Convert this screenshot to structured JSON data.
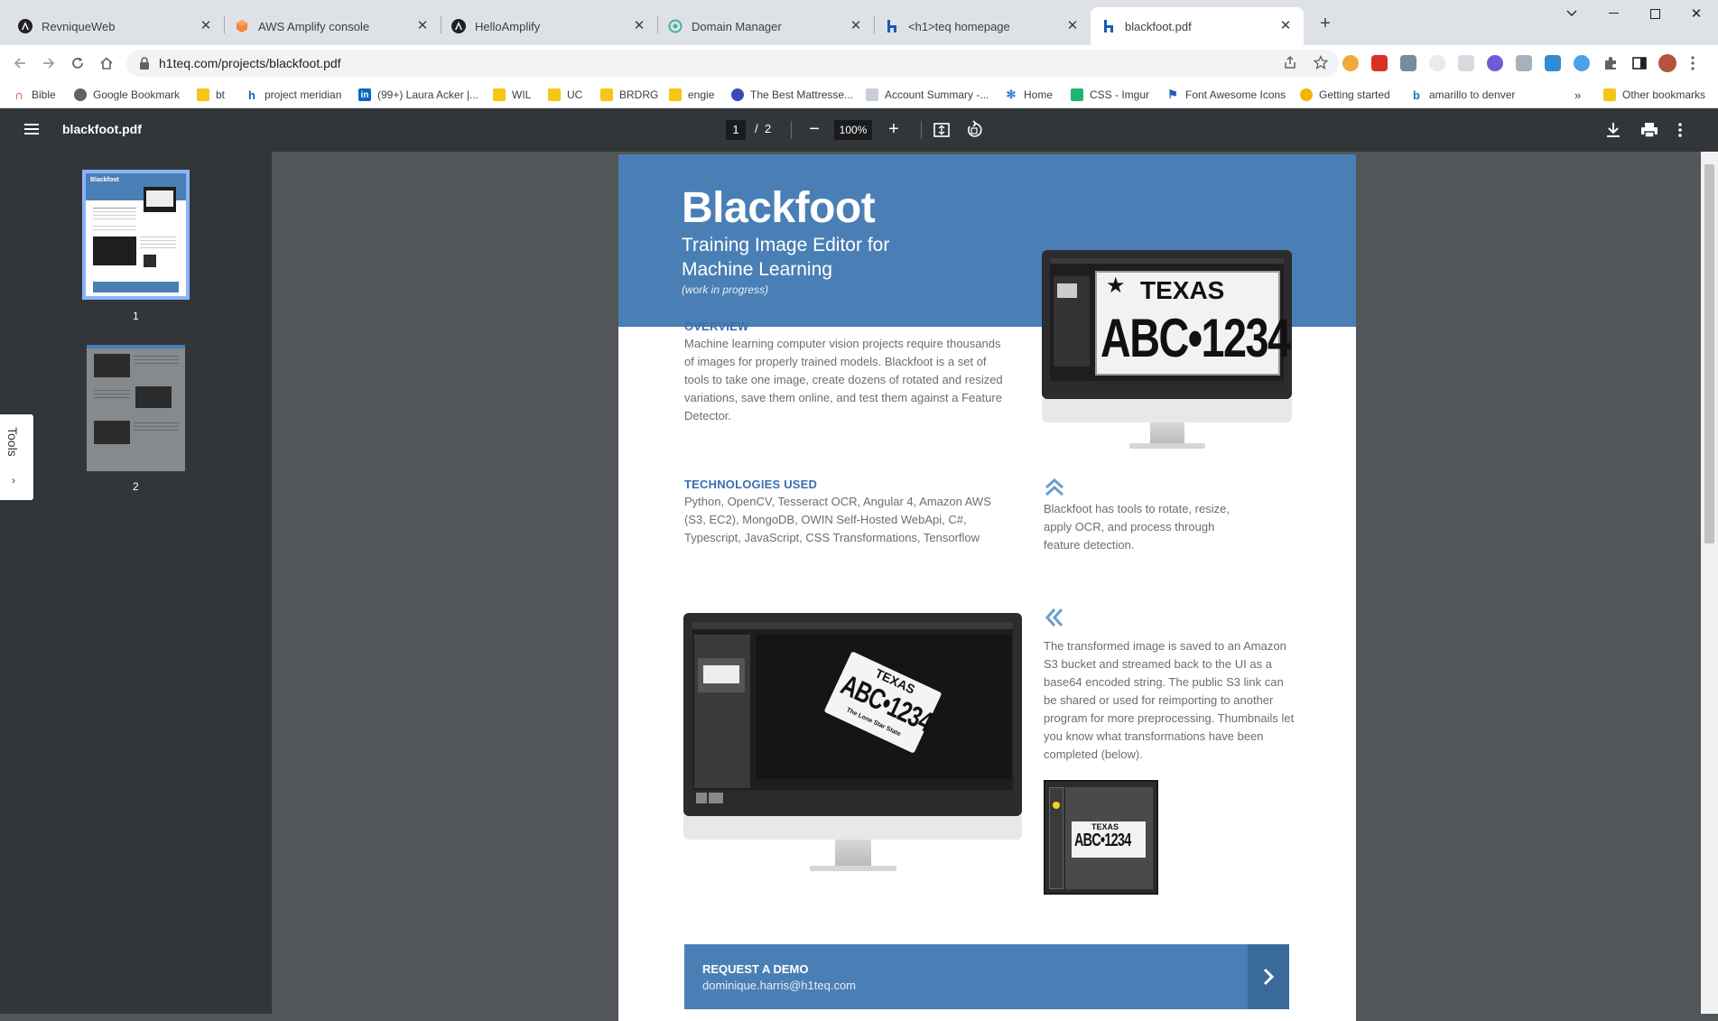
{
  "tabs": [
    {
      "title": "RevniqueWeb",
      "icon": "angular-icon"
    },
    {
      "title": "AWS Amplify console",
      "icon": "aws-icon"
    },
    {
      "title": "HelloAmplify",
      "icon": "angular-icon"
    },
    {
      "title": "Domain Manager",
      "icon": "domain-icon"
    },
    {
      "title": "<h1>teq homepage",
      "icon": "h1teq-icon"
    },
    {
      "title": "blackfoot.pdf",
      "icon": "h1teq-icon"
    }
  ],
  "address": {
    "url": "h1teq.com/projects/blackfoot.pdf"
  },
  "bookmarks": [
    {
      "label": "Bible"
    },
    {
      "label": "Google Bookmark"
    },
    {
      "label": "bt"
    },
    {
      "label": "project meridian"
    },
    {
      "label": "(99+) Laura Acker |..."
    },
    {
      "label": "WIL"
    },
    {
      "label": "UC"
    },
    {
      "label": "BRDRG"
    },
    {
      "label": "engie"
    },
    {
      "label": "The Best Mattresse..."
    },
    {
      "label": "Account Summary -..."
    },
    {
      "label": "Home"
    },
    {
      "label": "CSS - Imgur"
    },
    {
      "label": "Font Awesome Icons"
    },
    {
      "label": "Getting started"
    },
    {
      "label": "amarillo to denver"
    }
  ],
  "bookmarks_overflow": "»",
  "other_bookmarks": "Other bookmarks",
  "pdf": {
    "filename": "blackfoot.pdf",
    "current_page": "1",
    "separator": "/",
    "total_pages": "2",
    "zoom": "100%",
    "tools_label": "Tools",
    "thumbnails": [
      "1",
      "2"
    ]
  },
  "doc": {
    "title": "Blackfoot",
    "subtitle": "Training Image Editor for Machine Learning",
    "note": "(work in progress)",
    "overview_heading": "OVERVIEW",
    "overview_text": "Machine learning computer vision projects require thousands of images for properly trained models. Blackfoot is a set of tools to take one image, create dozens of rotated and resized variations, save them online, and test them against a Feature Detector.",
    "tech_heading": "TECHNOLOGIES USED",
    "tech_text": "Python, OpenCV, Tesseract OCR, Angular 4, Amazon AWS (S3, EC2), MongoDB, OWIN Self-Hosted WebApi, C#, Typescript, JavaScript, CSS Transformations, Tensorflow",
    "tools_text": "Blackfoot has tools to rotate, resize, apply OCR, and process through feature detection.",
    "saved_text": "The transformed image is saved to an Amazon S3 bucket and streamed back to the UI as a base64 encoded string. The public S3 link can be shared or used for reimporting to another program for more preprocessing. Thumbnails let you know what transformations have been completed (below).",
    "plate_state": "TEXAS",
    "plate_number": "ABC•1234",
    "plate_tagline": "The Lone Star State",
    "cta_title": "REQUEST A DEMO",
    "cta_email": "dominique.harris@h1teq.com"
  }
}
